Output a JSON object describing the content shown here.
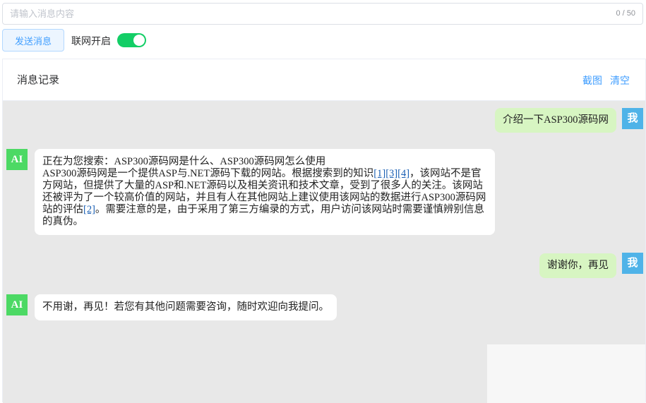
{
  "input": {
    "placeholder": "请输入消息内容",
    "value": "",
    "counter": "0 / 50"
  },
  "controls": {
    "send_label": "发送消息",
    "network_label": "联网开启",
    "network_on": true,
    "switch_color": "#13ce66"
  },
  "panel": {
    "title": "消息记录",
    "screenshot_label": "截图",
    "clear_label": "清空"
  },
  "messages": [
    {
      "role": "user",
      "avatar": "我",
      "text": "介绍一下ASP300源码网"
    },
    {
      "role": "ai",
      "avatar": "AI",
      "line1": "正在为您搜索：ASP300源码网是什么、ASP300源码网怎么使用",
      "p1": "ASP300源码网是一个提供ASP与.NET源码下载的网站。根据搜索到的知识",
      "cite1": "[1]",
      "cite2": "[3]",
      "cite3": "[4]",
      "p2": "，该网站不是官方网站，但提供了大量的ASP和.NET源码以及相关资讯和技术文章，受到了很多人的关注。该网站还被评为了一个较高价值的网站，并且有人在其他网站上建议使用该网站的数据进行ASP300源码网站的评估",
      "cite4": "[2]",
      "p3": "。需要注意的是，由于采用了第三方编录的方式，用户访问该网站时需要谨慎辨别信息的真伪。"
    },
    {
      "role": "user",
      "avatar": "我",
      "text": "谢谢你，再见"
    },
    {
      "role": "ai",
      "avatar": "AI",
      "text": "不用谢，再见！若您有其他问题需要咨询，随时欢迎向我提问。"
    }
  ],
  "colors": {
    "accent": "#409eff",
    "user_bubble": "#d7f5c2",
    "ai_avatar": "#4cd964",
    "user_avatar": "#4fb3e8",
    "chat_bg": "#e8e8e8"
  }
}
